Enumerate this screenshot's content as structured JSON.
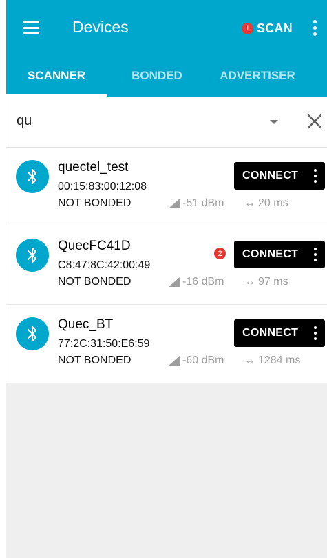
{
  "toolbar": {
    "title": "Devices",
    "scan_badge": "1",
    "scan_label": "SCAN"
  },
  "tabs": [
    {
      "label": "SCANNER",
      "active": true
    },
    {
      "label": "BONDED",
      "active": false
    },
    {
      "label": "ADVERTISER",
      "active": false
    }
  ],
  "search": {
    "value": "qu"
  },
  "devices": [
    {
      "name": "quectel_test",
      "address": "00:15:83:00:12:08",
      "bond_state": "NOT BONDED",
      "rssi": "-51 dBm",
      "interval": "20 ms",
      "connect_label": "CONNECT",
      "badge": ""
    },
    {
      "name": "QuecFC41D",
      "address": "C8:47:8C:42:00:49",
      "bond_state": "NOT BONDED",
      "rssi": "-16 dBm",
      "interval": "97 ms",
      "connect_label": "CONNECT",
      "badge": "2"
    },
    {
      "name": "Quec_BT",
      "address": "77:2C:31:50:E6:59",
      "bond_state": "NOT BONDED",
      "rssi": "-60 dBm",
      "interval": "1284 ms",
      "connect_label": "CONNECT",
      "badge": ""
    }
  ],
  "colors": {
    "primary": "#00a7cc",
    "badge": "#e53935",
    "connect_button": "#000000"
  },
  "icons": {
    "menu": "menu-icon",
    "overflow": "more-vert-icon",
    "dropdown": "arrow-drop-down-icon",
    "clear": "close-icon",
    "device": "bluetooth-icon",
    "rssi": "signal-strength-icon",
    "interval": "left-right-arrow-icon"
  }
}
